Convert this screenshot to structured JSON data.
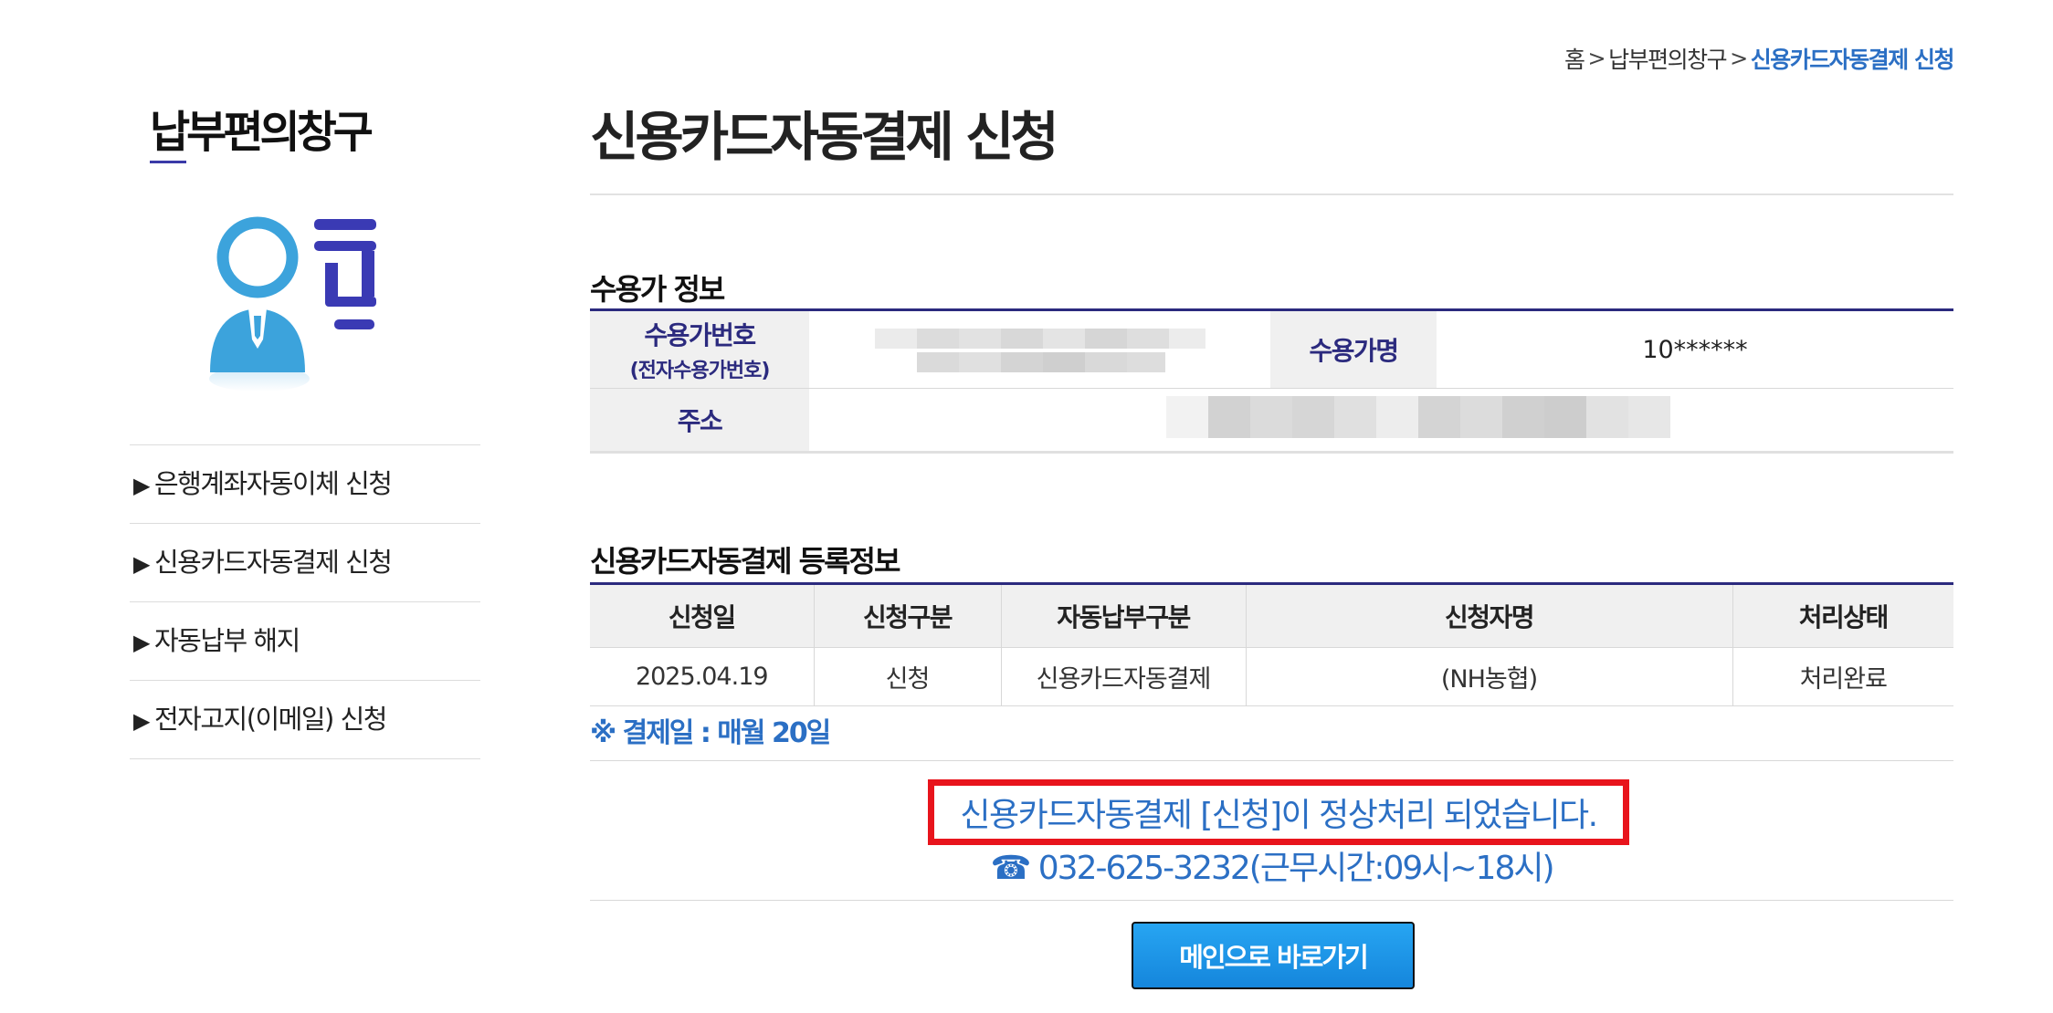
{
  "breadcrumb": {
    "home": "홈",
    "parent": "납부편의창구",
    "current": "신용카드자동결제 신청"
  },
  "sidebar": {
    "title": "납부편의창구",
    "profile_icon": "user-document-icon",
    "items": [
      {
        "label": "은행계좌자동이체 신청"
      },
      {
        "label": "신용카드자동결제 신청"
      },
      {
        "label": "자동납부 해지"
      },
      {
        "label": "전자고지(이메일) 신청"
      }
    ]
  },
  "main": {
    "title": "신용카드자동결제 신청",
    "customer_info": {
      "section_title": "수용가 정보",
      "customer_number_label": "수용가번호",
      "customer_number_sublabel": "(전자수용가번호)",
      "customer_name_label": "수용가명",
      "customer_name_value": "10******",
      "address_label": "주소"
    },
    "registration": {
      "section_title": "신용카드자동결제 등록정보",
      "columns": [
        "신청일",
        "신청구분",
        "자동납부구분",
        "신청자명",
        "처리상태"
      ],
      "rows": [
        [
          "2025.04.19",
          "신청",
          "신용카드자동결제",
          "(NH농협)",
          "처리완료"
        ]
      ]
    },
    "payment_day": "※ 결제일 : 매월 20일",
    "result_message": "신용카드자동결제 [신청]이 정상처리 되었습니다.",
    "contact": "☎ 032-625-3232(근무시간:09시~18시)",
    "main_button": "메인으로 바로가기"
  },
  "colors": {
    "accent_blue": "#2b6fc4",
    "navy": "#2b2a7e",
    "alert_red": "#e8141c",
    "button_blue": "#1e96e8"
  }
}
